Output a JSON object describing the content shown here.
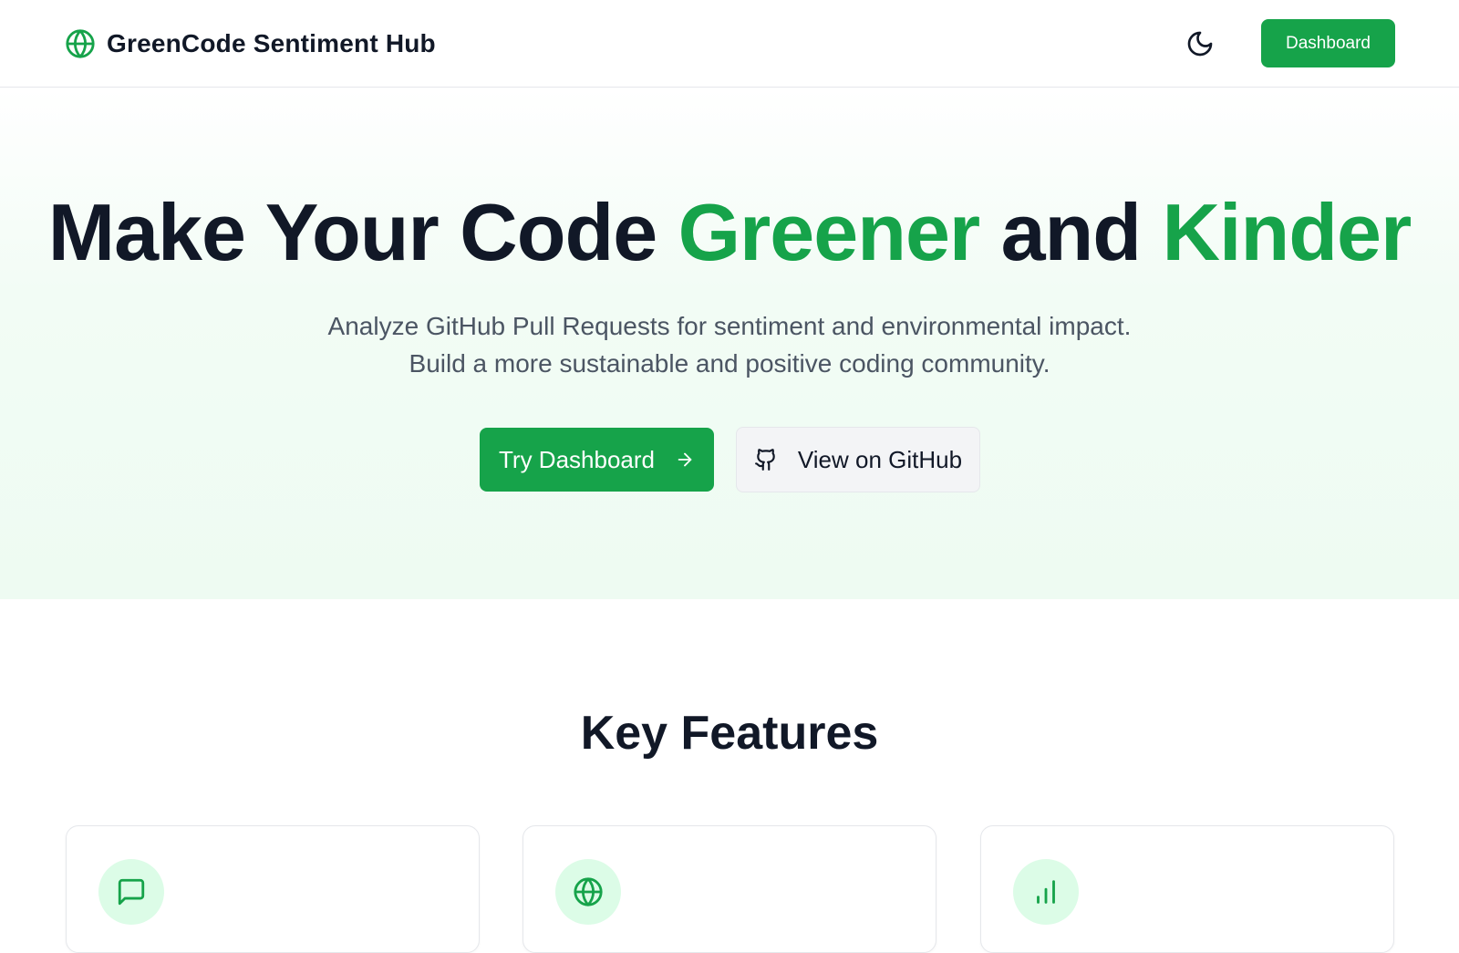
{
  "header": {
    "brand_icon": "globe-icon",
    "title": "GreenCode Sentiment Hub",
    "theme_toggle_icon": "moon-icon",
    "dashboard_label": "Dashboard"
  },
  "hero": {
    "title_part1": "Make Your Code ",
    "title_accent1": "Greener",
    "title_part2": " and ",
    "title_accent2": "Kinder",
    "subtitle_line1": "Analyze GitHub Pull Requests for sentiment and environmental impact.",
    "subtitle_line2": "Build a more sustainable and positive coding community.",
    "primary_button_label": "Try Dashboard",
    "primary_button_icon": "arrow-right-icon",
    "secondary_button_label": "View on GitHub",
    "secondary_button_icon": "github-icon"
  },
  "features": {
    "title": "Key Features",
    "cards": [
      {
        "icon": "message-square-icon"
      },
      {
        "icon": "globe-icon"
      },
      {
        "icon": "bar-chart-icon"
      }
    ]
  },
  "colors": {
    "accent": "#16a34a",
    "accent_light": "#dcfce7",
    "text_dark": "#111827",
    "text_muted": "#4b5563"
  }
}
